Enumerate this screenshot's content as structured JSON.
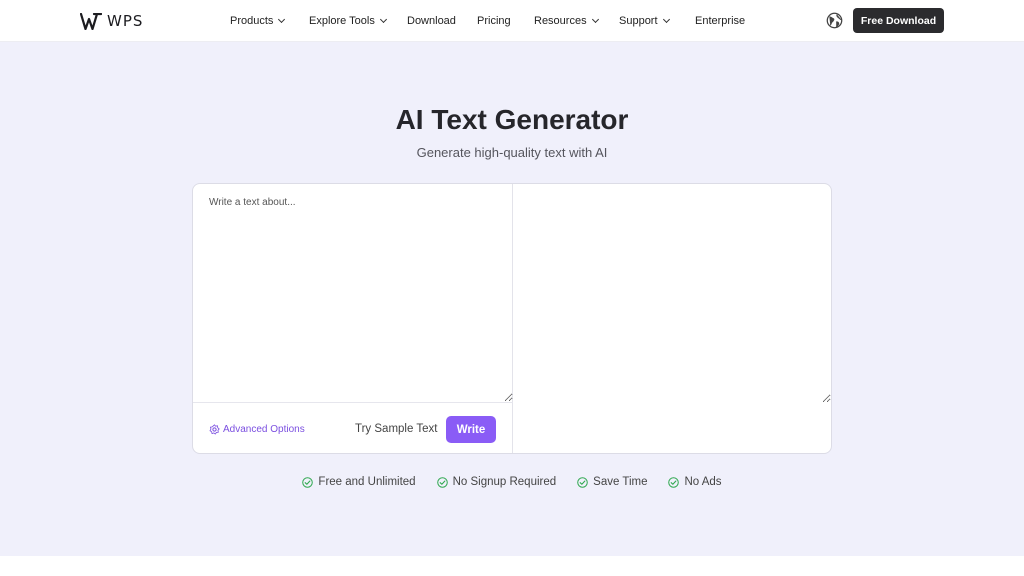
{
  "header": {
    "logo_text": "WPS",
    "nav": [
      {
        "label": "Products",
        "dropdown": true
      },
      {
        "label": "Explore Tools",
        "dropdown": true
      },
      {
        "label": "Download",
        "dropdown": false
      },
      {
        "label": "Pricing",
        "dropdown": false
      },
      {
        "label": "Resources",
        "dropdown": true
      },
      {
        "label": "Support",
        "dropdown": true
      },
      {
        "label": "Enterprise",
        "dropdown": false
      }
    ],
    "language_icon": "globe-icon",
    "cta_label": "Free Download"
  },
  "hero": {
    "title": "AI Text Generator",
    "subtitle": "Generate high-quality text with AI"
  },
  "editor": {
    "input_placeholder": "Write a text about...",
    "input_value": "",
    "output_value": "",
    "advanced_label": "Advanced Options",
    "advanced_icon": "settings-icon",
    "sample_label": "Try Sample Text",
    "write_label": "Write"
  },
  "features": [
    {
      "label": "Free and Unlimited",
      "icon": "check-circle-icon"
    },
    {
      "label": "No Signup Required",
      "icon": "check-circle-icon"
    },
    {
      "label": "Save Time",
      "icon": "check-circle-icon"
    },
    {
      "label": "No Ads",
      "icon": "check-circle-icon"
    }
  ],
  "colors": {
    "accent": "#8a5cf6",
    "accent_text": "#7b4fe0",
    "check_green": "#2fa84f",
    "hero_bg": "#f0f0fb",
    "cta_bg": "#2b2b2e"
  }
}
